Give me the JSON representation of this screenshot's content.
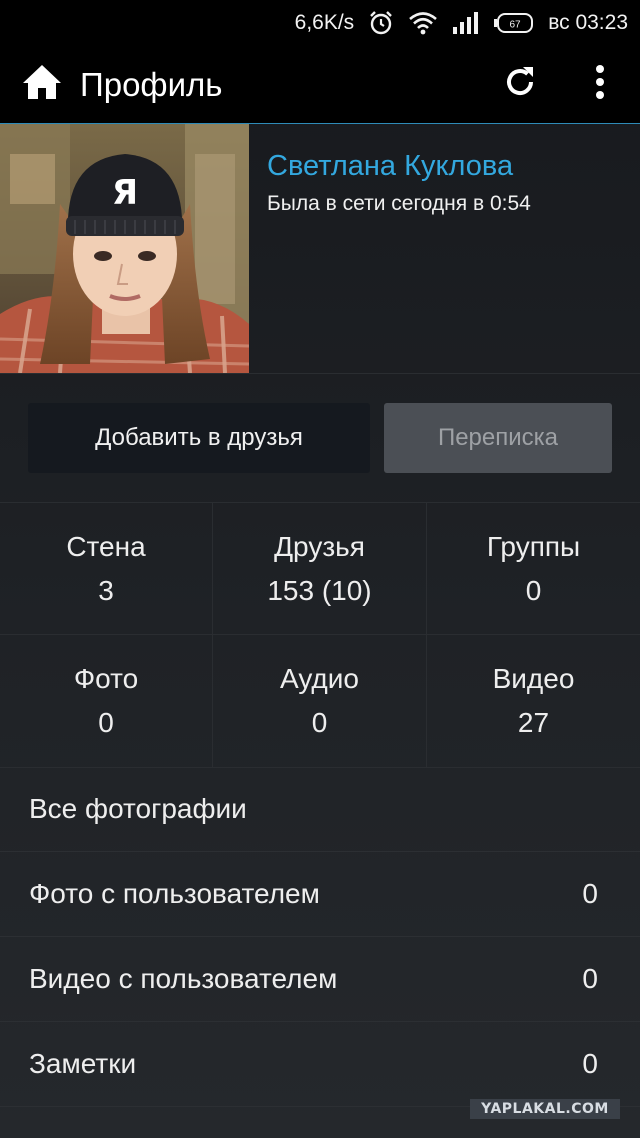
{
  "status_bar": {
    "speed": "6,6K/s",
    "battery_level": "67",
    "day_time": "вс 03:23",
    "icons": [
      "alarm-icon",
      "wifi-icon",
      "signal-icon",
      "battery-icon"
    ]
  },
  "action_bar": {
    "title": "Профиль",
    "icons": [
      "home-icon",
      "refresh-icon",
      "overflow-menu-icon"
    ]
  },
  "profile": {
    "name": "Светлана Куклова",
    "status": "Была в сети сегодня в 0:54",
    "avatar_cap_letter": "Я"
  },
  "buttons": {
    "add_friend": "Добавить в друзья",
    "messages": "Переписка"
  },
  "stats": [
    {
      "label": "Стена",
      "value": "3"
    },
    {
      "label": "Друзья",
      "value": "153 (10)"
    },
    {
      "label": "Группы",
      "value": "0"
    },
    {
      "label": "Фото",
      "value": "0"
    },
    {
      "label": "Аудио",
      "value": "0"
    },
    {
      "label": "Видео",
      "value": "27"
    }
  ],
  "list": [
    {
      "label": "Все фотографии",
      "count": ""
    },
    {
      "label": "Фото с пользователем",
      "count": "0"
    },
    {
      "label": "Видео с пользователем",
      "count": "0"
    },
    {
      "label": "Заметки",
      "count": "0"
    }
  ],
  "watermark": "YAPLAKAL.COM",
  "colors": {
    "accent": "#33a8df",
    "background": "#1f2226",
    "action_bar": "#000000",
    "button_dark": "#15191f",
    "button_disabled": "#4b4f55"
  }
}
